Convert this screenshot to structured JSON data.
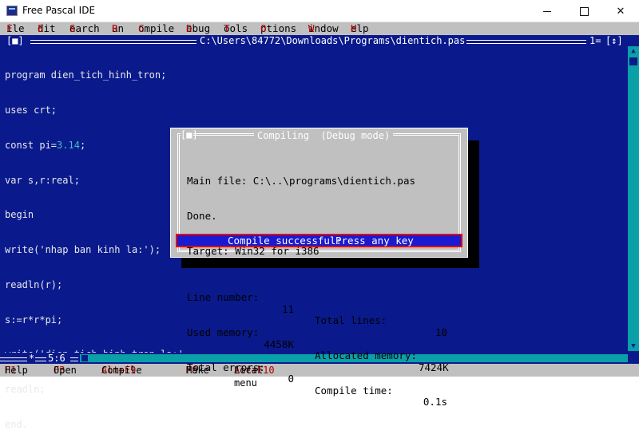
{
  "window": {
    "title": "Free Pascal IDE"
  },
  "menu": {
    "items": [
      {
        "hotkey": "F",
        "rest": "ile"
      },
      {
        "hotkey": "E",
        "rest": "dit"
      },
      {
        "hotkey": "S",
        "rest": "earch"
      },
      {
        "hotkey": "R",
        "rest": "un"
      },
      {
        "hotkey": "C",
        "rest": "ompile"
      },
      {
        "hotkey": "D",
        "rest": "ebug"
      },
      {
        "hotkey": "T",
        "rest": "ools"
      },
      {
        "hotkey": "O",
        "rest": "ptions"
      },
      {
        "hotkey": "W",
        "rest": "indow"
      },
      {
        "hotkey": "H",
        "rest": "elp"
      }
    ]
  },
  "editor": {
    "close_box": "[■]",
    "file_path": "C:\\Users\\84772\\Downloads\\Programs\\dientich.pas",
    "window_number": "1=",
    "zoom_box": "[↕]",
    "lines": [
      {
        "pre": "program dien_tich_hinh_tron;",
        "num": "",
        "post": ""
      },
      {
        "pre": "uses crt;",
        "num": "",
        "post": ""
      },
      {
        "pre": "const pi=",
        "num": "3.14",
        "post": ";"
      },
      {
        "pre": "var s,r:real;",
        "num": "",
        "post": ""
      },
      {
        "pre": "begin",
        "num": "",
        "post": ""
      },
      {
        "pre": "write('nhap ban kinh la:');",
        "num": "",
        "post": ""
      },
      {
        "pre": "readln(r);",
        "num": "",
        "post": ""
      },
      {
        "pre": "s:=r*r*pi;",
        "num": "",
        "post": ""
      },
      {
        "pre": "write('dien tich hinh tron la:'",
        "num": "",
        "post": ""
      },
      {
        "pre": "readln;",
        "num": "",
        "post": ""
      },
      {
        "pre": "end.",
        "num": "",
        "post": ""
      }
    ],
    "modified_marker": "*",
    "cursor_position": "5:6"
  },
  "dialog": {
    "close_box": "[■]",
    "title": "Compiling  (Debug mode)",
    "main_file_label": "Main file: ",
    "main_file_value": "C:\\..\\programs\\dientich.pas",
    "done_text": "Done.",
    "target_text": "Target: Win32 for i386",
    "stats": [
      {
        "label1": "Line number:",
        "value1": "11",
        "label2": "Total lines:",
        "value2": "10"
      },
      {
        "label1": "Used memory:",
        "value1": "4458K",
        "label2": "Allocated memory:",
        "value2": "7424K"
      },
      {
        "label1": "Total errors:",
        "value1": "0",
        "label2": "Compile time:",
        "value2": "0.1s"
      }
    ],
    "status_part1": "Compile successful:",
    "status_part2": "Press any key"
  },
  "statusbar": {
    "items": [
      {
        "key": "F1",
        "label": "Help"
      },
      {
        "key": "F3",
        "label": "Open"
      },
      {
        "key": "Alt+F9",
        "label": "Compile"
      },
      {
        "key": "F9",
        "label": "Make"
      },
      {
        "key": "Alt+F10",
        "label": "Local menu"
      }
    ]
  },
  "colors": {
    "editor_bg": "#0a1a8c",
    "menu_bg": "#c0c0c0",
    "hotkey": "#b00000",
    "dialog_bg": "#c0c0c0",
    "status_highlight": "#1a1ad0",
    "status_border": "#e00000"
  }
}
